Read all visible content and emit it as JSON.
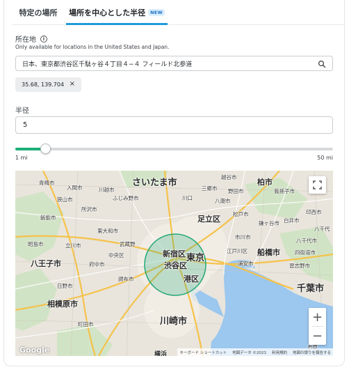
{
  "tabs": [
    {
      "label": "特定の場所"
    },
    {
      "label": "場所を中心とした半径",
      "badge": "NEW",
      "active": true
    }
  ],
  "location": {
    "label": "所在地",
    "help": "Only available for locations in the United States and Japan.",
    "search_value": "日本、東京都渋谷区千駄ヶ谷４丁目４−４ フィールド北参道",
    "chip": "35.68, 139.704"
  },
  "radius": {
    "label": "半径",
    "value": "5",
    "slider_fraction": 0.094,
    "min_label": "1 mi",
    "max_label": "50 mi"
  },
  "colors": {
    "accent_tab": "#1f9bd8",
    "slider_fill": "#1fb07a",
    "circle": "#22a877",
    "water": "#9cc7ee"
  },
  "map": {
    "labels": {
      "saitama": "さいたま市",
      "kashiwa": "柏市",
      "adachi": "足立区",
      "tokyo": "東京",
      "shinjuku": "新宿区",
      "shibuya": "渋谷区",
      "minato": "港区",
      "funabashi": "船橋市",
      "chiba": "千葉市",
      "hachioji": "八王子市",
      "kawasaki": "川崎市",
      "sagamihara": "相模原市",
      "yokohama": "横浜",
      "koshigaya": "越谷市",
      "kawaguchi": "川口",
      "tokorozawa": "所沢市",
      "tachikawa": "立川市",
      "fuchu": "府中市",
      "chofu": "調布市",
      "machida": "町田市",
      "ichikawa": "市川市",
      "matsudo": "松戸市",
      "narashino": "習志野市",
      "yachiyo": "八千代市",
      "kamagaya": "鎌ヶ谷市",
      "noda": "野田市",
      "yashio": "八潮市",
      "misato": "三郷市",
      "abiko": "我孫子市",
      "inzai": "印西市",
      "shiroi": "白井市",
      "ome": "青梅市",
      "iruma": "入間市",
      "sayama": "狭山市",
      "kawagoe": "川越市",
      "fujimino": "ふじみ野市",
      "akishima": "昭島市",
      "hino": "日野市",
      "nakano": "中央区",
      "higashiyamato": "東大和市",
      "musashino": "武蔵野",
      "hanno": "飯能市",
      "urayasu": "浦安市",
      "ichihara": "市原",
      "edogawa": "江戸川区",
      "yotsukaido": "四街道市",
      "yachimata": "八千代"
    },
    "google": "Google",
    "attribution": [
      "キーボード ショートカット",
      "地図データ ©2023",
      "利用規約",
      "地図の誤りを報告する"
    ]
  },
  "icons": {
    "info": "i",
    "chip_close": "×",
    "zoom_in": "+",
    "zoom_out": "−"
  }
}
